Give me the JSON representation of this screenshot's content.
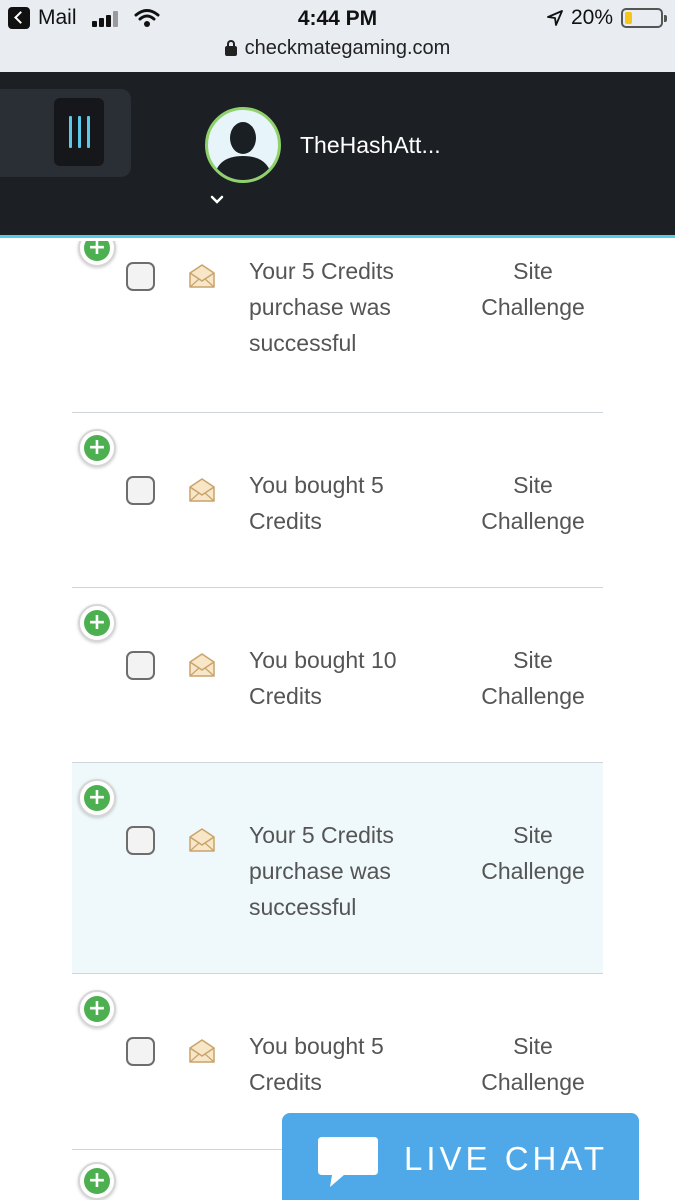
{
  "status_bar": {
    "back_label": "Mail",
    "time": "4:44 PM",
    "battery": "20%",
    "battery_level": 0.2,
    "url": "checkmategaming.com",
    "icons": [
      "back-icon",
      "cellular-signal-icon",
      "wifi-icon",
      "location-arrow-icon",
      "battery-icon",
      "lock-icon"
    ]
  },
  "header": {
    "username": "TheHashAtt...",
    "menu_icon": "menu-bars-icon",
    "avatar_icon": "user-silhouette-icon",
    "dropdown_icon": "chevron-down-icon"
  },
  "notifications": [
    {
      "message": "Your 5 Credits purchase was successful",
      "category": "Site Challenge",
      "highlighted": false
    },
    {
      "message": "You bought 5 Credits",
      "category": "Site Challenge",
      "highlighted": false
    },
    {
      "message": "You bought 10 Credits",
      "category": "Site Challenge",
      "highlighted": false
    },
    {
      "message": "Your 5 Credits purchase was successful",
      "category": "Site Challenge",
      "highlighted": true
    },
    {
      "message": "You bought 5 Credits",
      "category": "Site Challenge",
      "highlighted": false
    }
  ],
  "row_icons": {
    "expand": "+",
    "envelope": "open-envelope-icon"
  },
  "live_chat": {
    "label": "LIVE CHAT",
    "icon": "chat-bubble-icon"
  },
  "colors": {
    "header_bg": "#1c1f24",
    "accent_cyan": "#5bc9e8",
    "avatar_ring": "#8fd16a",
    "expand_green": "#4caf50",
    "highlight_row": "#eff8fa",
    "live_chat_blue": "#4fa8e8"
  }
}
